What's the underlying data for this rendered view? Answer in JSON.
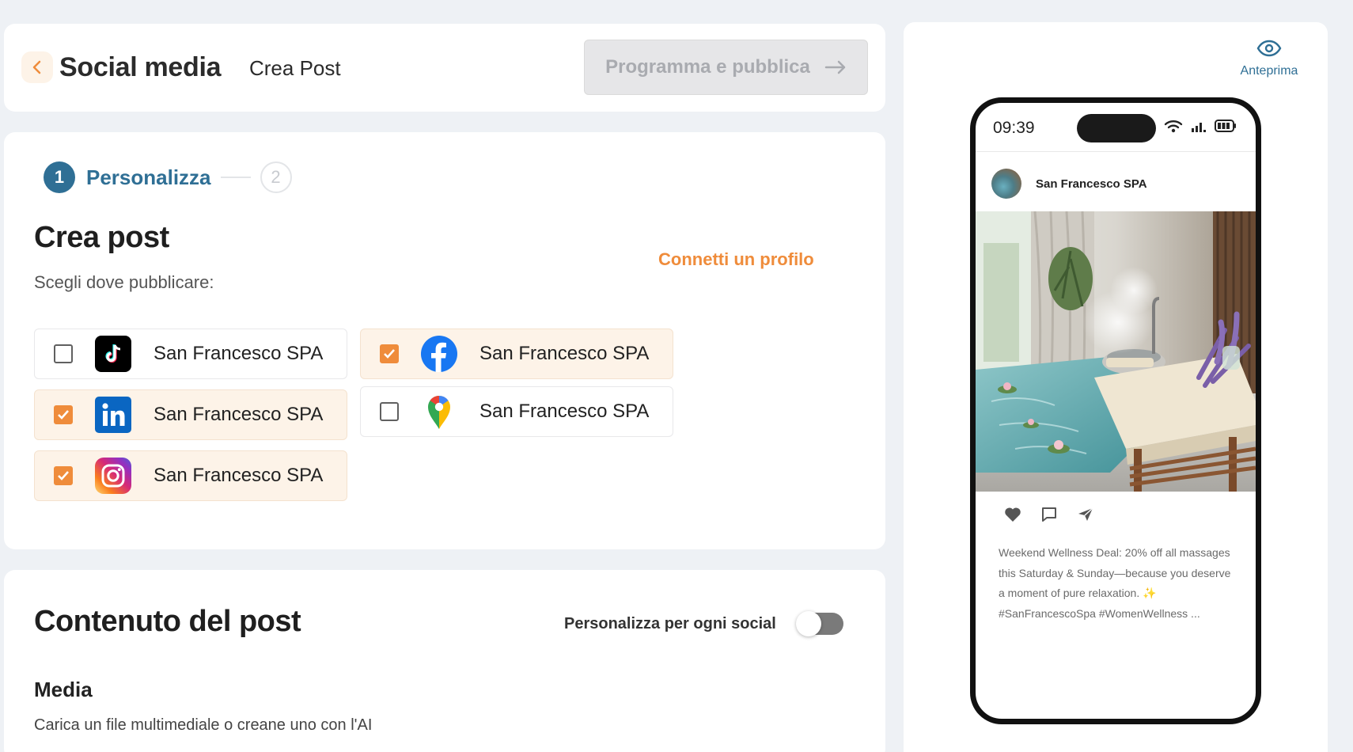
{
  "header": {
    "title": "Social media",
    "subtitle": "Crea Post",
    "publish_label": "Programma e pubblica"
  },
  "stepper": {
    "step1_number": "1",
    "step1_label": "Personalizza",
    "step2_number": "2"
  },
  "create_post": {
    "title": "Crea post",
    "subtitle": "Scegli dove pubblicare:",
    "connect_link": "Connetti un profilo"
  },
  "channels": [
    {
      "network": "tiktok",
      "label": "San Francesco SPA",
      "checked": false
    },
    {
      "network": "facebook",
      "label": "San Francesco SPA",
      "checked": true
    },
    {
      "network": "linkedin",
      "label": "San Francesco SPA",
      "checked": true
    },
    {
      "network": "google-maps",
      "label": "San Francesco SPA",
      "checked": false
    },
    {
      "network": "instagram",
      "label": "San Francesco SPA",
      "checked": true
    }
  ],
  "content": {
    "title": "Contenuto del post",
    "toggle_label": "Personalizza per ogni social",
    "toggle_on": false,
    "media_title": "Media",
    "media_subtitle": "Carica un file multimediale o creane uno con l'AI"
  },
  "preview": {
    "button_label": "Anteprima",
    "phone_time": "09:39",
    "account_name": "San Francesco SPA",
    "caption": "Weekend Wellness Deal: 20% off all massages this Saturday & Sunday—because you deserve a moment of pure relaxation. ✨ #SanFrancescoSpa #WomenWellness ..."
  },
  "colors": {
    "accent": "#ef8c3b",
    "primary": "#2f6f95",
    "background": "#eef1f5"
  }
}
